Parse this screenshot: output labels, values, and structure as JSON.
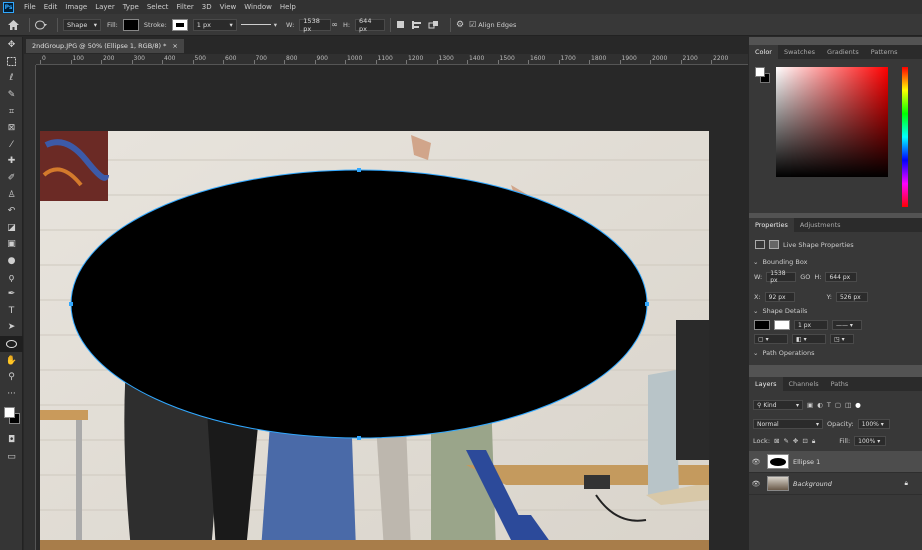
{
  "app": {
    "logo": "Ps"
  },
  "menu": [
    "File",
    "Edit",
    "Image",
    "Layer",
    "Type",
    "Select",
    "Filter",
    "3D",
    "View",
    "Window",
    "Help"
  ],
  "options": {
    "mode": "Shape",
    "fill_label": "Fill:",
    "stroke_label": "Stroke:",
    "stroke_width": "1 px",
    "w_label": "W:",
    "w_value": "1538 px",
    "h_label": "H:",
    "h_value": "644 px",
    "align_edges": "Align Edges"
  },
  "document": {
    "tab_title": "2ndGroup.JPG @ 50% (Ellipse 1, RGB/8) *",
    "close": "×"
  },
  "ruler": {
    "h_labels": [
      "0",
      "100",
      "200",
      "300",
      "400",
      "500",
      "600",
      "700",
      "800",
      "900",
      "1000",
      "1100",
      "1200",
      "1300",
      "1400",
      "1500",
      "1600",
      "1700",
      "1800",
      "1900",
      "2000",
      "2100",
      "2200"
    ]
  },
  "color_panel": {
    "tabs": [
      "Color",
      "Swatches",
      "Gradients",
      "Patterns"
    ]
  },
  "properties_panel": {
    "tabs": [
      "Properties",
      "Adjustments"
    ],
    "title": "Live Shape Properties",
    "bounding_box": "Bounding Box",
    "w_label": "W:",
    "w_value": "1538 px",
    "go_label": "GO",
    "h_label": "H:",
    "h_value": "644 px",
    "x_label": "X:",
    "x_value": "92 px",
    "y_label": "Y:",
    "y_value": "526 px",
    "shape_details": "Shape Details",
    "stroke_w": "1 px",
    "path_ops": "Path Operations"
  },
  "layers_panel": {
    "tabs": [
      "Layers",
      "Channels",
      "Paths"
    ],
    "filter_kind": "Kind",
    "blend_mode": "Normal",
    "opacity_label": "Opacity:",
    "opacity_value": "100%",
    "lock_label": "Lock:",
    "fill_label": "Fill:",
    "fill_value": "100%",
    "layers": [
      {
        "name": "Ellipse 1"
      },
      {
        "name": "Background"
      }
    ]
  },
  "colors": {
    "accent": "#31a8ff",
    "shape_fill": "#000000"
  }
}
